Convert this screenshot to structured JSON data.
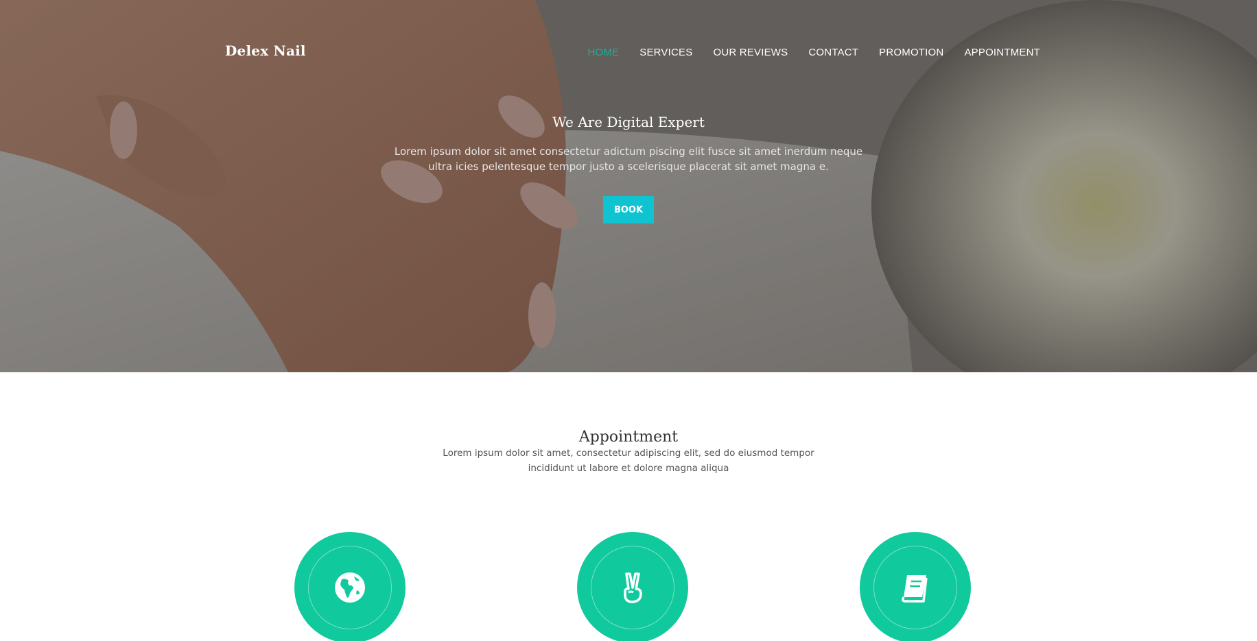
{
  "site": {
    "brand": "Delex Nail"
  },
  "nav": {
    "items": [
      {
        "label": "HOME",
        "active": true
      },
      {
        "label": "SERVICES",
        "active": false
      },
      {
        "label": "OUR REVIEWS",
        "active": false
      },
      {
        "label": "CONTACT",
        "active": false
      },
      {
        "label": "PROMOTION",
        "active": false
      },
      {
        "label": "APPOINTMENT",
        "active": false
      }
    ]
  },
  "hero": {
    "title": "We Are Digital Expert",
    "text": "Lorem ipsum dolor sit amet consectetur adictum piscing elit fusce sit amet inerdum neque ultra icies pelentesque tempor justo a scelerisque placerat sit amet magna e.",
    "button_label": "BOOK"
  },
  "appointment": {
    "title": "Appointment",
    "text": "Lorem ipsum dolor sit amet, consectetur adipiscing elit, sed do eiusmod tempor incididunt ut labore et dolore magna aliqua",
    "features": [
      {
        "icon": "globe-icon"
      },
      {
        "icon": "peace-hand-icon"
      },
      {
        "icon": "book-icon"
      }
    ]
  },
  "colors": {
    "accent_green": "#10c99c",
    "nav_active": "#13b59b",
    "book_button": "#10c3d1"
  }
}
